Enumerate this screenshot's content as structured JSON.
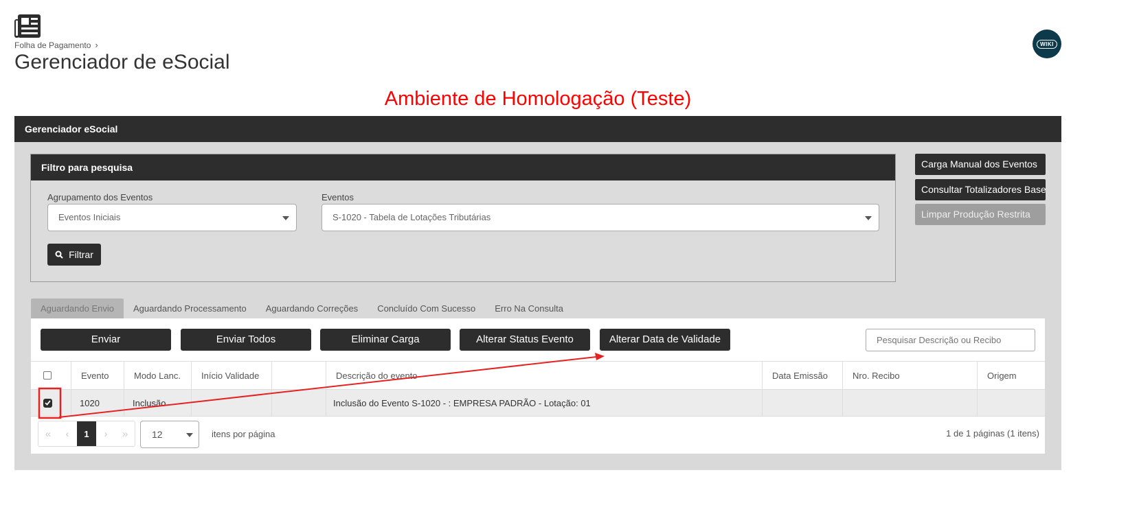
{
  "header": {
    "app_icon": "newspaper-icon",
    "breadcrumb": "Folha de Pagamento",
    "title": "Gerenciador de eSocial",
    "wiki_label": "WIKI"
  },
  "environment_banner": "Ambiente de Homologação (Teste)",
  "panel": {
    "title": "Gerenciador eSocial",
    "filter": {
      "title": "Filtro para pesquisa",
      "group_label": "Agrupamento dos Eventos",
      "group_value": "Eventos Iniciais",
      "events_label": "Eventos",
      "events_value": "S-1020 - Tabela de Lotações Tributárias",
      "filter_button": "Filtrar"
    },
    "side_buttons": {
      "manual_load": "Carga Manual dos Eventos",
      "totalizers": "Consultar Totalizadores Base",
      "clear_restricted": "Limpar Produção Restrita"
    },
    "tabs": [
      {
        "label": "Aguardando Envio",
        "active": true
      },
      {
        "label": "Aguardando Processamento",
        "active": false
      },
      {
        "label": "Aguardando Correções",
        "active": false
      },
      {
        "label": "Concluído Com Sucesso",
        "active": false
      },
      {
        "label": "Erro Na Consulta",
        "active": false
      }
    ],
    "actions": {
      "send": "Enviar",
      "send_all": "Enviar Todos",
      "delete_load": "Eliminar Carga",
      "change_status": "Alterar Status Evento",
      "change_validity": "Alterar Data de Validade",
      "search_placeholder": "Pesquisar Descrição ou Recibo"
    },
    "table": {
      "columns": {
        "evento": "Evento",
        "modo": "Modo Lanc.",
        "inicio": "Início Validade",
        "blank": "",
        "descricao": "Descrição do evento",
        "data_emissao": "Data Emissão",
        "recibo": "Nro. Recibo",
        "origem": "Origem"
      },
      "rows": [
        {
          "checked": true,
          "evento": "1020",
          "modo": "Inclusão",
          "inicio": "",
          "blank": "",
          "descricao": "Inclusão do Evento S-1020 - : EMPRESA PADRÃO - Lotação: 01",
          "data_emissao": "",
          "recibo": "",
          "origem": ""
        }
      ]
    },
    "pagination": {
      "first": "«",
      "prev": "‹",
      "current_page": "1",
      "next": "›",
      "last": "»",
      "page_size": "12",
      "per_page_label": "itens por página",
      "info": "1 de 1 páginas (1 itens)"
    }
  },
  "colors": {
    "dark": "#2d2d2d",
    "panel_bg": "#d9d9d9",
    "banner": "#ff0000",
    "annotation": "#e52222",
    "wiki_bg": "#0c3a4a"
  }
}
